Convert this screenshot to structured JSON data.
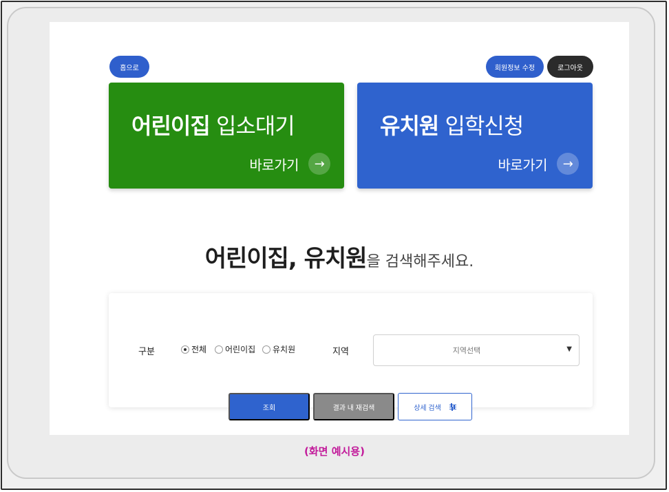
{
  "header": {
    "home_label": "홈으로",
    "member_edit_label": "회원정보 수정",
    "logout_label": "로그아웃"
  },
  "cards": {
    "daycare": {
      "title_strong": "어린이집",
      "title_light": " 입소대기",
      "link_label": "바로가기",
      "color": "#268d11"
    },
    "kindergarten": {
      "title_strong": "유치원",
      "title_light": " 입학신청",
      "link_label": "바로가기",
      "color": "#2f63ce"
    }
  },
  "headline": {
    "strong": "어린이집, 유치원",
    "light": "을 검색해주세요."
  },
  "search": {
    "category_label": "구분",
    "options": [
      {
        "label": "전체",
        "checked": true
      },
      {
        "label": "어린이집",
        "checked": false
      },
      {
        "label": "유치원",
        "checked": false
      }
    ],
    "region_label": "지역",
    "region_value": "지역선택",
    "search_button": "조회",
    "refine_button": "결과 내 재검색",
    "detail_button": "상세 검색"
  },
  "caption": "(화면 예시용)",
  "colors": {
    "accent_blue": "#2f63ce",
    "green": "#268d11",
    "caption_magenta": "#c21a9a"
  }
}
